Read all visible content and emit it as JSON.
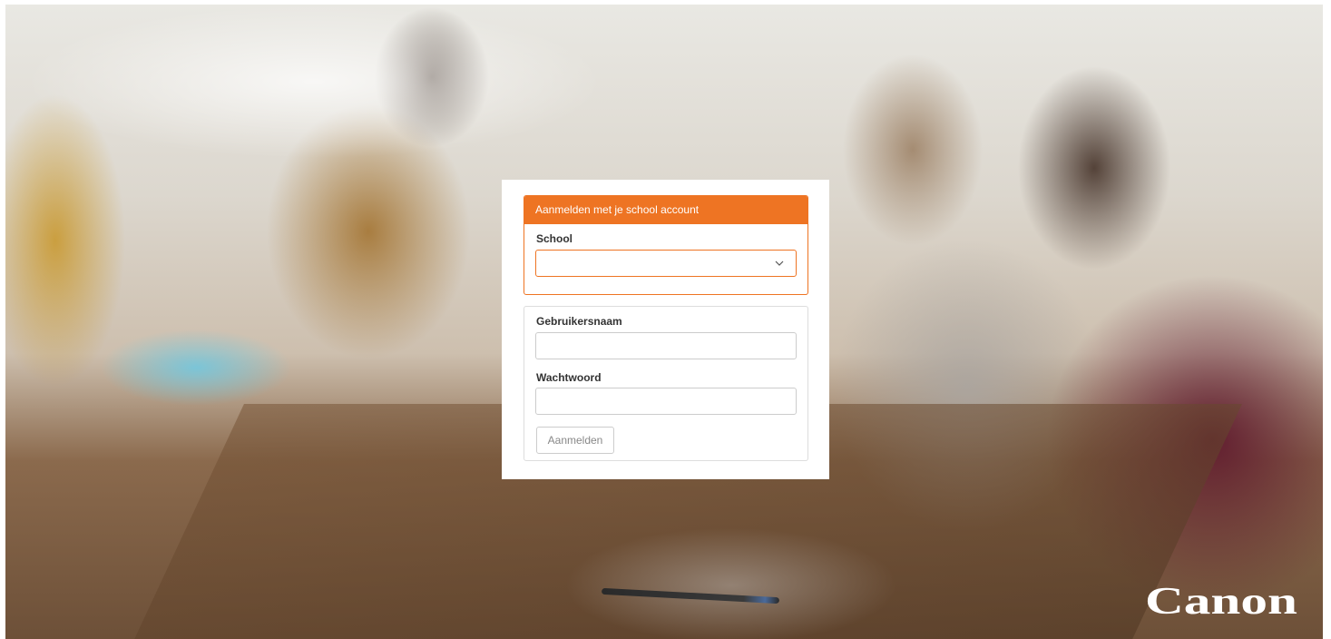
{
  "login": {
    "header": "Aanmelden met je school account",
    "school_label": "School",
    "school_selected": "",
    "username_label": "Gebruikersnaam",
    "username_value": "",
    "password_label": "Wachtwoord",
    "password_value": "",
    "submit_label": "Aanmelden"
  },
  "brand": {
    "logo_text": "Canon"
  },
  "colors": {
    "accent": "#ee7423",
    "panel": "#ffffff",
    "logo": "#ffffff"
  },
  "icons": {
    "select_chevron": "chevron-down-icon"
  }
}
